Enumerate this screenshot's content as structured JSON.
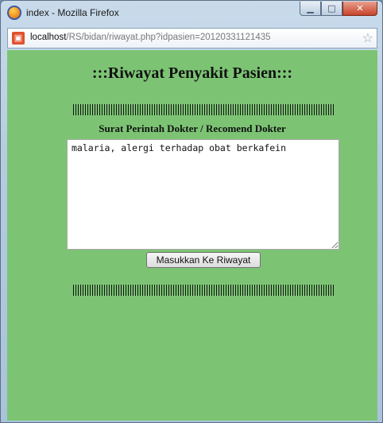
{
  "window": {
    "title": "index - Mozilla Firefox"
  },
  "urlbar": {
    "host": "localhost",
    "path": "/RS/bidan/riwayat.php?idpasien=20120331121435"
  },
  "page": {
    "heading": ":::Riwayat Penyakit Pasien:::",
    "subheading": "Surat Perintah Dokter / Recomend Dokter",
    "textarea_value": "malaria, alergi terhadap obat berkafein",
    "submit_label": "Masukkan Ke Riwayat"
  },
  "colors": {
    "page_background": "#7cc474"
  }
}
